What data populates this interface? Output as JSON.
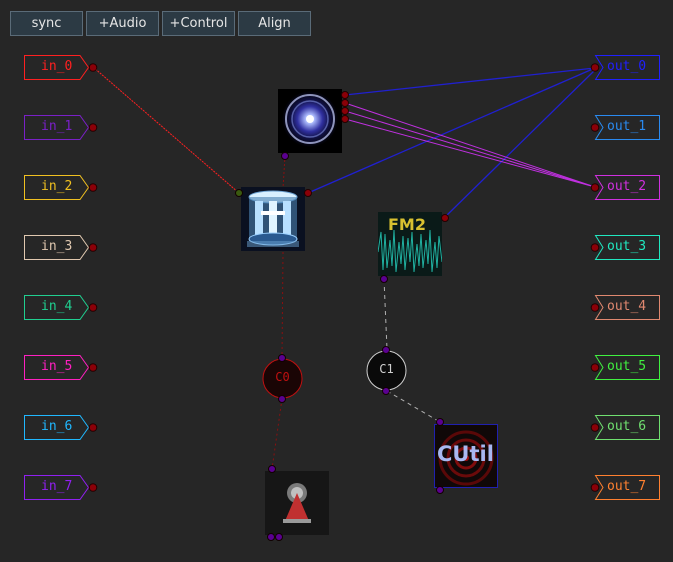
{
  "toolbar": {
    "sync": "sync",
    "add_audio": "+Audio",
    "add_control": "+Control",
    "align": "Align"
  },
  "inputs": [
    {
      "label": "in_0",
      "color": "#ff2020"
    },
    {
      "label": "in_1",
      "color": "#7a20c8"
    },
    {
      "label": "in_2",
      "color": "#f0c020"
    },
    {
      "label": "in_3",
      "color": "#e0c8b0"
    },
    {
      "label": "in_4",
      "color": "#20d090"
    },
    {
      "label": "in_5",
      "color": "#ff20c0"
    },
    {
      "label": "in_6",
      "color": "#20b8ff"
    },
    {
      "label": "in_7",
      "color": "#9020f0"
    }
  ],
  "outputs": [
    {
      "label": "out_0",
      "color": "#2020ff"
    },
    {
      "label": "out_1",
      "color": "#2a8af0"
    },
    {
      "label": "out_2",
      "color": "#d030e0"
    },
    {
      "label": "out_3",
      "color": "#20e8c0"
    },
    {
      "label": "out_4",
      "color": "#e08870"
    },
    {
      "label": "out_5",
      "color": "#40f040"
    },
    {
      "label": "out_6",
      "color": "#70e070"
    },
    {
      "label": "out_7",
      "color": "#ff8030"
    }
  ],
  "modules": {
    "fm2_label": "FM2",
    "cutil_label": "CUtil",
    "c0_label": "C0",
    "c1_label": "C1"
  },
  "colors": {
    "background": "#262626",
    "audio_wire": "#2020d0",
    "purple_wire": "#c030e0",
    "red_wire": "#ff2020",
    "control_wire": "#b0b0b0",
    "port_dot": "#8a0008",
    "cv_dot": "#5a0090"
  }
}
